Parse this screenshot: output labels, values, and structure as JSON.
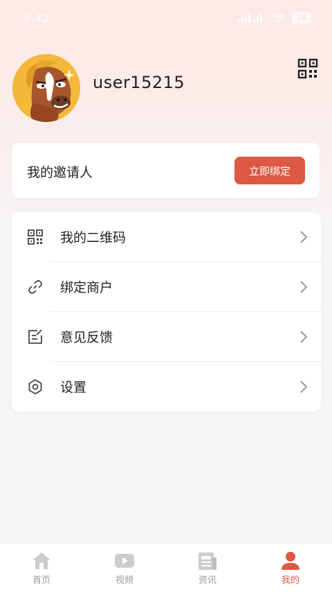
{
  "status_bar": {
    "time": "9:42",
    "battery": "78"
  },
  "profile": {
    "username": "user15215"
  },
  "inviter": {
    "label": "我的邀请人",
    "bind_button": "立即绑定"
  },
  "menu": [
    {
      "label": "我的二维码",
      "icon": "qr-code-icon"
    },
    {
      "label": "绑定商户",
      "icon": "link-icon"
    },
    {
      "label": "意见反馈",
      "icon": "feedback-icon"
    },
    {
      "label": "设置",
      "icon": "settings-icon"
    }
  ],
  "tabs": [
    {
      "label": "首页",
      "icon": "home-icon",
      "active": false
    },
    {
      "label": "视频",
      "icon": "video-icon",
      "active": false
    },
    {
      "label": "资讯",
      "icon": "news-icon",
      "active": false
    },
    {
      "label": "我的",
      "icon": "user-icon",
      "active": true
    }
  ],
  "colors": {
    "accent": "#dc5943",
    "inactive": "#9a9a9a",
    "page_bg": "#f7f6f6"
  }
}
